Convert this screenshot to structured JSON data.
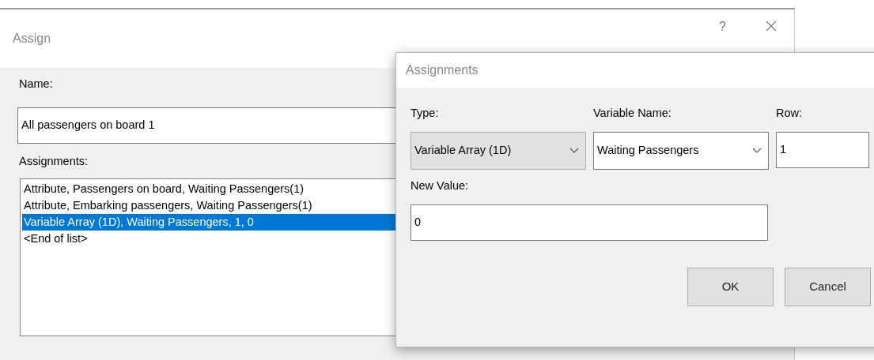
{
  "back_dialog": {
    "title": "Assign",
    "help_button": "?",
    "name_label": "Name:",
    "name_value": "All passengers on board 1",
    "assignments_label": "Assignments:",
    "assignments": [
      {
        "text": "Attribute, Passengers on board, Waiting Passengers(1)",
        "selected": false
      },
      {
        "text": "Attribute, Embarking passengers, Waiting Passengers(1)",
        "selected": false
      },
      {
        "text": "Variable Array (1D), Waiting Passengers, 1, 0",
        "selected": true
      },
      {
        "text": "<End of list>",
        "selected": false
      }
    ]
  },
  "front_dialog": {
    "title": "Assignments",
    "type_label": "Type:",
    "type_value": "Variable Array (1D)",
    "variable_name_label": "Variable Name:",
    "variable_name_value": "Waiting Passengers",
    "row_label": "Row:",
    "row_value": "1",
    "new_value_label": "New Value:",
    "new_value": "0",
    "buttons": [
      "OK",
      "Cancel"
    ]
  }
}
